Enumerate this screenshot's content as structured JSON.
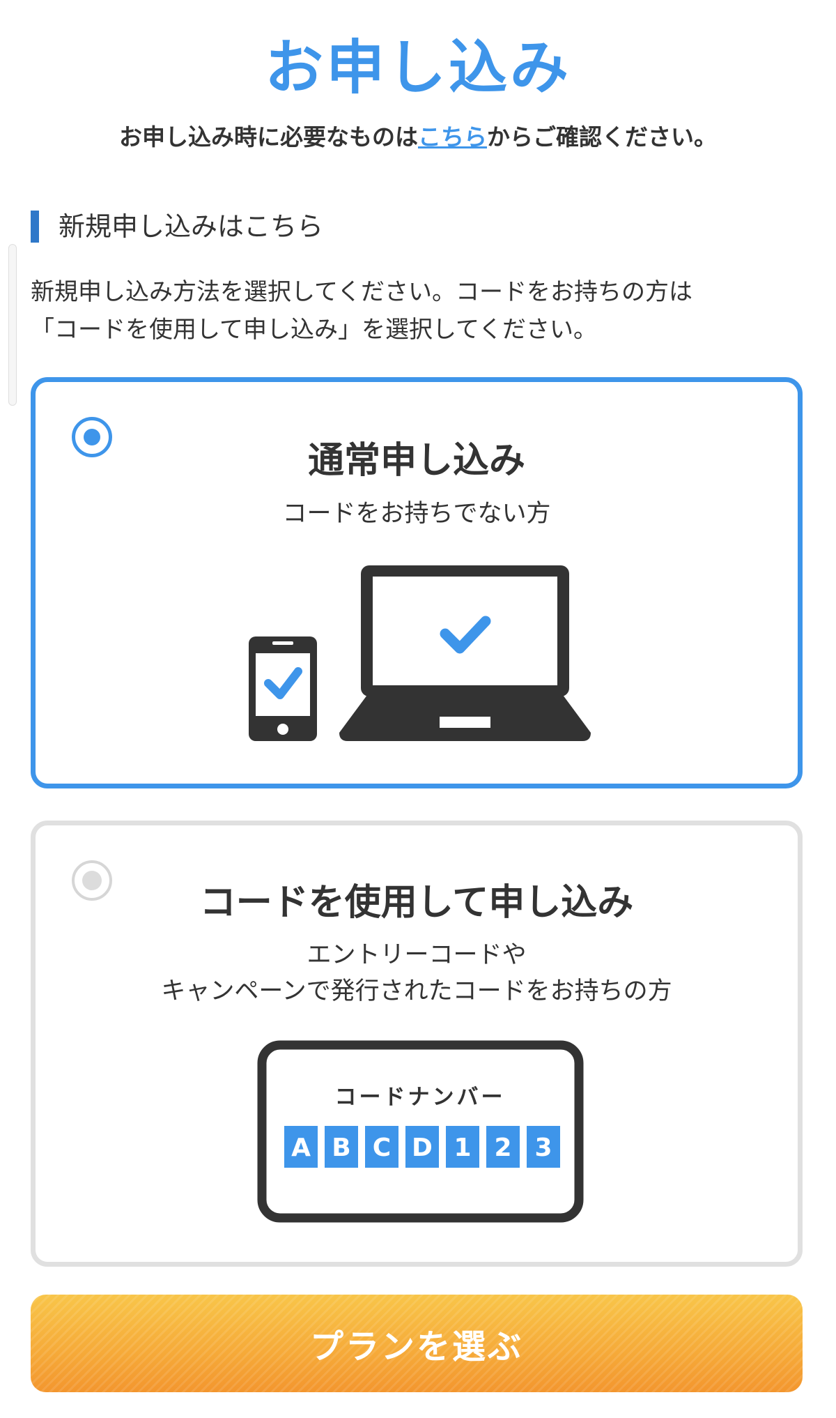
{
  "header": {
    "title": "お申し込み",
    "notice_before": "お申し込み時に必要なものは",
    "notice_link": "こちら",
    "notice_after": "からご確認ください。"
  },
  "section": {
    "heading": "新規申し込みはこちら",
    "instructions_line1": "新規申し込み方法を選択してください。コードをお持ちの方は",
    "instructions_line2": "「コードを使用して申し込み」を選択してください。"
  },
  "options": [
    {
      "title": "通常申し込み",
      "description_line1": "コードをお持ちでない方",
      "selected": true
    },
    {
      "title": "コードを使用して申し込み",
      "description_line1": "エントリーコードや",
      "description_line2": "キャンペーンで発行されたコードをお持ちの方",
      "selected": false,
      "code_label": "コードナンバー",
      "code_chars": [
        "A",
        "B",
        "C",
        "D",
        "1",
        "2",
        "3"
      ]
    }
  ],
  "cta": {
    "label": "プランを選ぶ"
  },
  "colors": {
    "accent": "#3e95ea",
    "heading_bar": "#2f78c9",
    "device_dark": "#333333",
    "cta_top": "#f8c549",
    "cta_bottom": "#f3962e",
    "unselected_border": "#e0e0e0"
  },
  "icons": {
    "radio_selected": "radio-selected-icon",
    "radio_unselected": "radio-unselected-icon",
    "devices": "smartphone-and-laptop-icon",
    "code_card": "code-number-card-icon"
  }
}
